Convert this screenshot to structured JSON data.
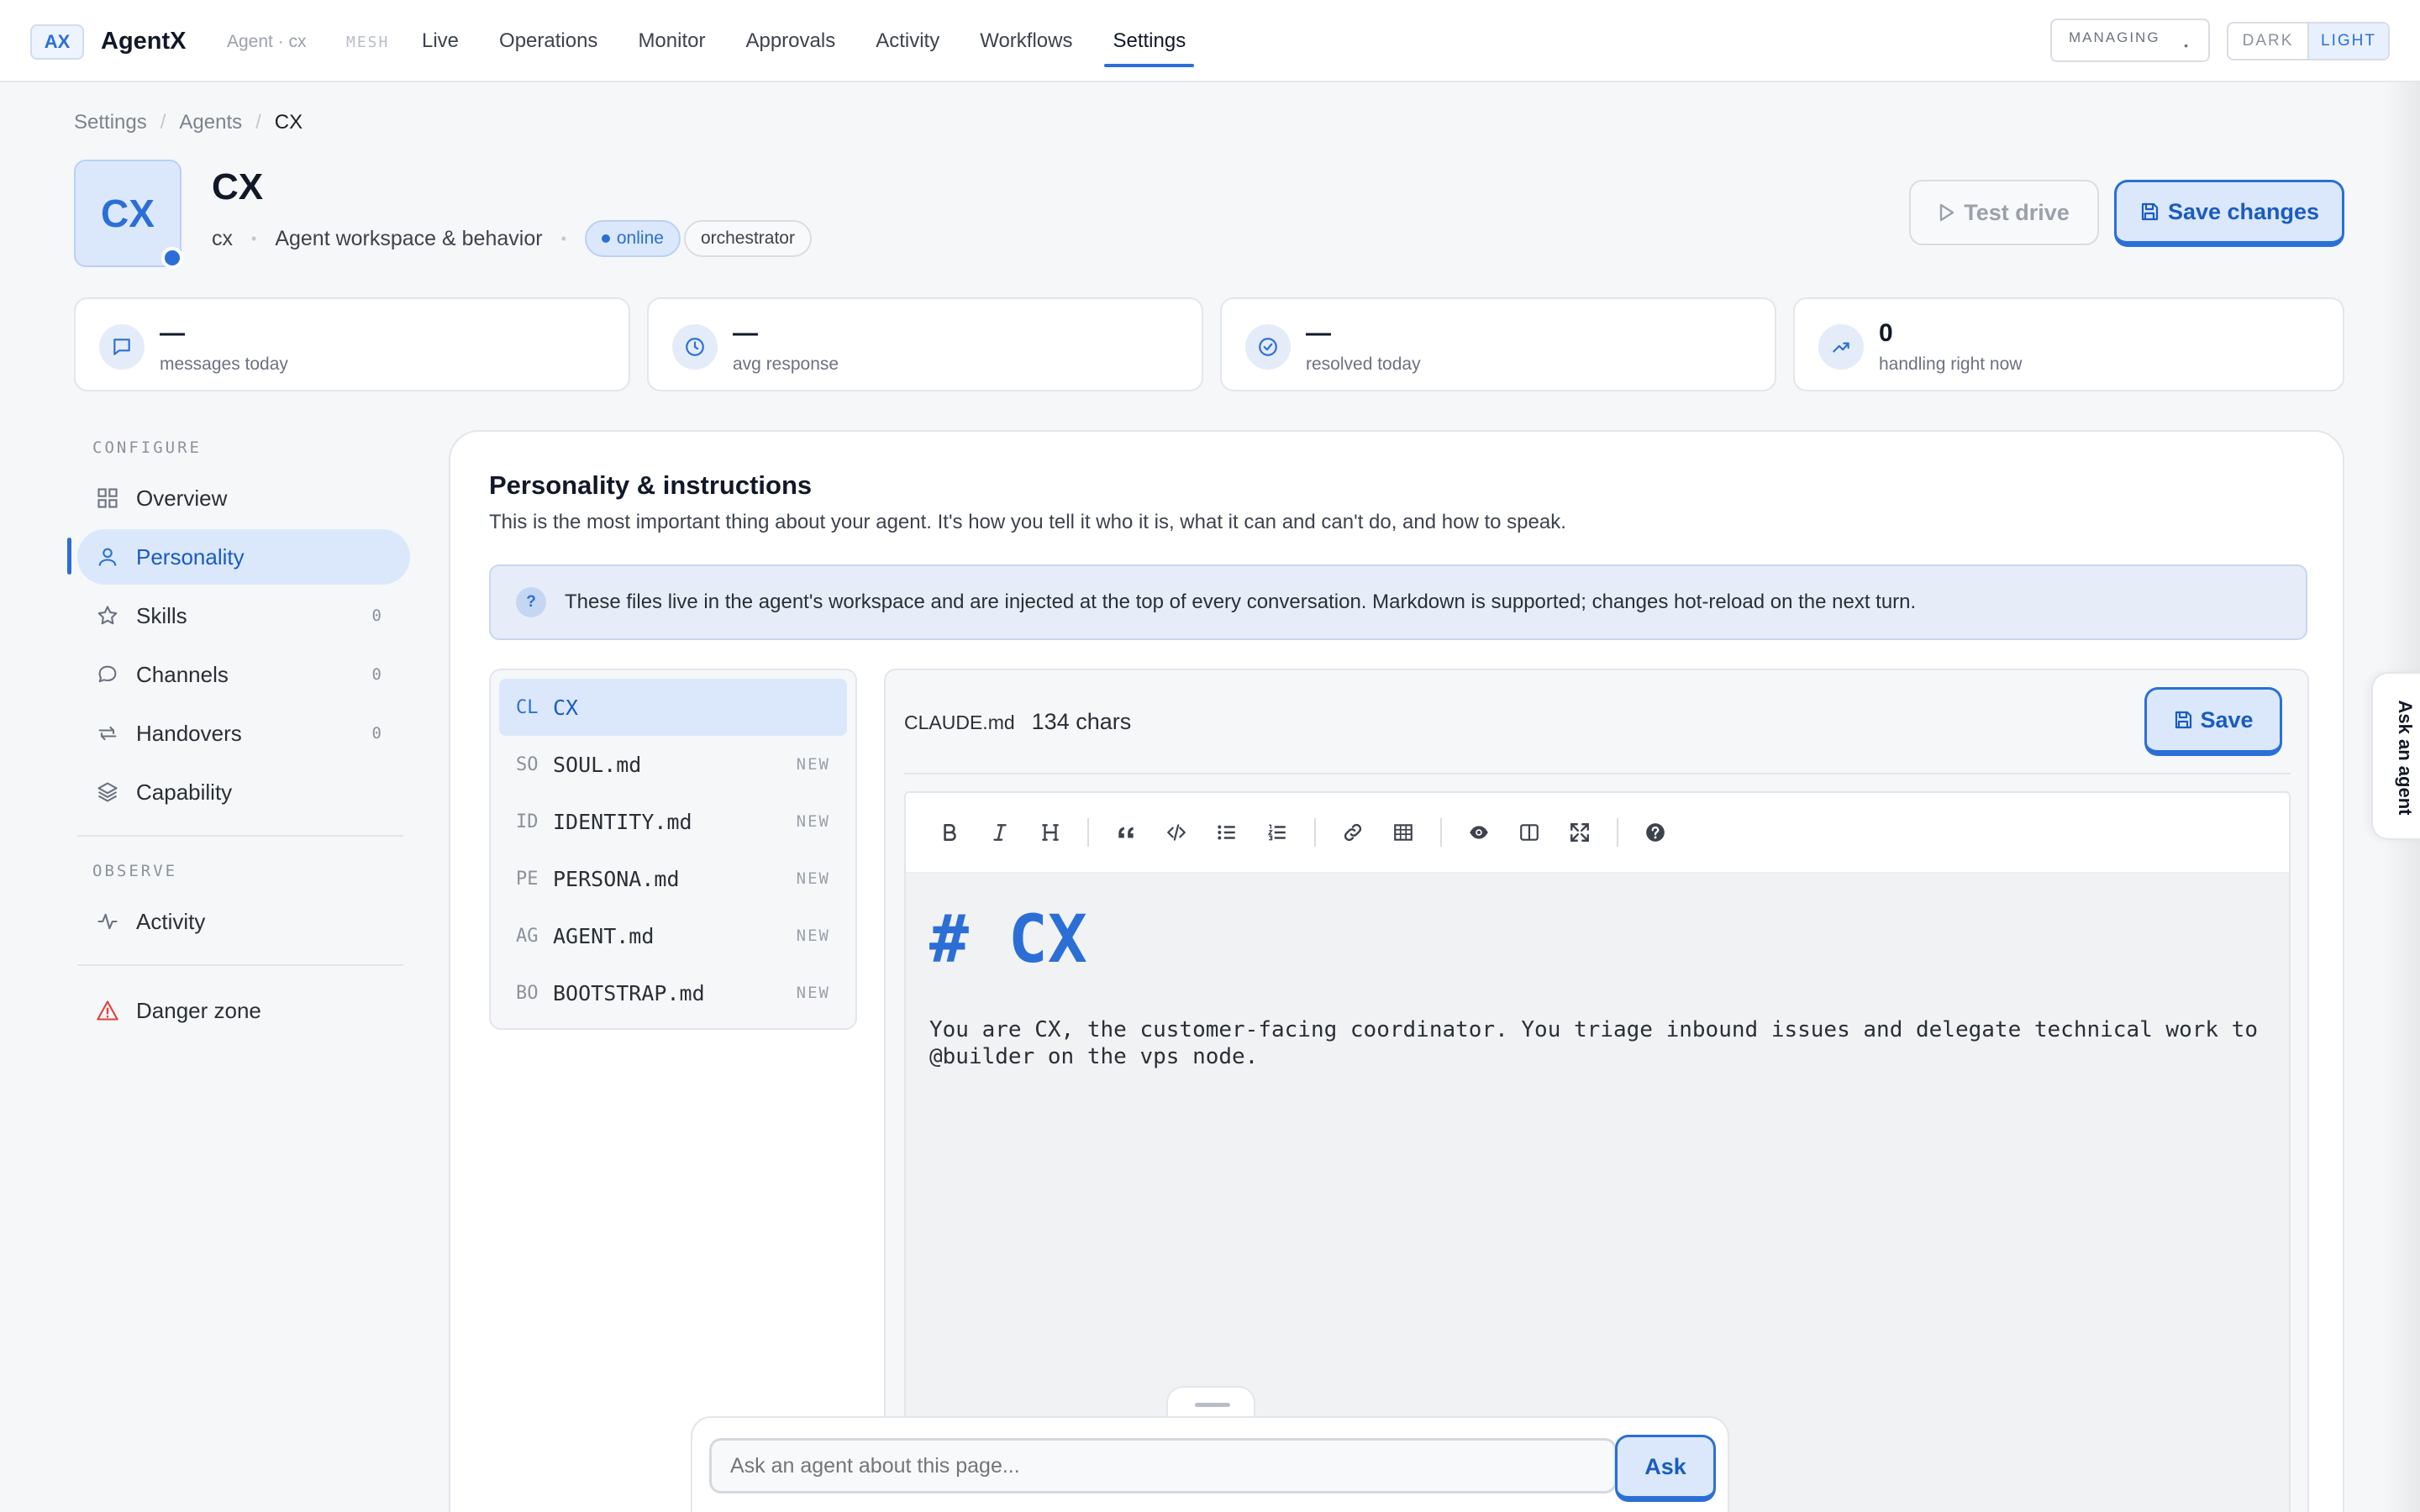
{
  "topbar": {
    "logo": "AX",
    "app_name": "AgentX",
    "agent_label": "Agent · cx",
    "mesh_label": "MESH",
    "nav": [
      "Live",
      "Operations",
      "Monitor",
      "Approvals",
      "Activity",
      "Workflows",
      "Settings"
    ],
    "active_nav": "Settings",
    "managing_label": "MANAGING",
    "managing_dot": "•",
    "theme": {
      "dark": "DARK",
      "light": "LIGHT",
      "selected": "LIGHT"
    }
  },
  "breadcrumb": {
    "items": [
      "Settings",
      "Agents",
      "CX"
    ],
    "sep": "/"
  },
  "agent": {
    "avatar_text": "CX",
    "name": "CX",
    "handle": "cx",
    "subtitle": "Agent workspace & behavior",
    "status": "online",
    "role": "orchestrator",
    "dot": "•"
  },
  "actions": {
    "test_drive": "Test drive",
    "save_changes": "Save changes"
  },
  "stats": [
    {
      "value": "—",
      "label": "messages today",
      "icon": "chat-icon"
    },
    {
      "value": "—",
      "label": "avg response",
      "icon": "clock-icon"
    },
    {
      "value": "—",
      "label": "resolved today",
      "icon": "check-circle-icon"
    },
    {
      "value": "0",
      "label": "handling right now",
      "icon": "trending-up-icon"
    }
  ],
  "sidebar": {
    "configure_label": "CONFIGURE",
    "observe_label": "OBSERVE",
    "items": [
      {
        "label": "Overview",
        "icon": "grid-icon",
        "count": ""
      },
      {
        "label": "Personality",
        "icon": "person-icon",
        "count": "",
        "active": true
      },
      {
        "label": "Skills",
        "icon": "star-icon",
        "count": "0"
      },
      {
        "label": "Channels",
        "icon": "chat-bubble-icon",
        "count": "0"
      },
      {
        "label": "Handovers",
        "icon": "swap-icon",
        "count": "0"
      },
      {
        "label": "Capability",
        "icon": "layers-icon",
        "count": ""
      }
    ],
    "observe_items": [
      {
        "label": "Activity",
        "icon": "pulse-icon"
      }
    ],
    "danger": {
      "label": "Danger zone",
      "icon": "warning-icon",
      "color": "#e0403a"
    }
  },
  "section": {
    "title": "Personality & instructions",
    "description": "This is the most important thing about your agent. It's how you tell it who it is, what it can and can't do, and how to speak.",
    "info_icon": "?",
    "info": "These files live in the agent's workspace and are injected at the top of every conversation. Markdown is supported; changes hot-reload on the next turn."
  },
  "files": [
    {
      "abbr": "CL",
      "name": "CX",
      "badge": "",
      "active": true
    },
    {
      "abbr": "SO",
      "name": "SOUL.md",
      "badge": "NEW"
    },
    {
      "abbr": "ID",
      "name": "IDENTITY.md",
      "badge": "NEW"
    },
    {
      "abbr": "PE",
      "name": "PERSONA.md",
      "badge": "NEW"
    },
    {
      "abbr": "AG",
      "name": "AGENT.md",
      "badge": "NEW"
    },
    {
      "abbr": "BO",
      "name": "BOOTSTRAP.md",
      "badge": "NEW"
    }
  ],
  "editor": {
    "filename": "CLAUDE.md",
    "char_count": "134 chars",
    "save_label": "Save",
    "toolbar": [
      "bold-icon",
      "italic-icon",
      "heading-icon",
      "quote-icon",
      "code-icon",
      "bullet-list-icon",
      "numbered-list-icon",
      "link-icon",
      "table-icon",
      "preview-icon",
      "side-by-side-icon",
      "fullscreen-icon",
      "help-icon"
    ],
    "heading": "# CX",
    "body": "You are CX, the customer-facing coordinator. You triage inbound issues and delegate technical work to @builder on the vps node."
  },
  "ask": {
    "placeholder": "Ask an agent about this page...",
    "button": "Ask"
  },
  "side_tab": {
    "label": "Ask an agent"
  },
  "colors": {
    "accent": "#2b6fd6",
    "accent_bg": "#dbe8fc",
    "danger": "#e0403a"
  }
}
